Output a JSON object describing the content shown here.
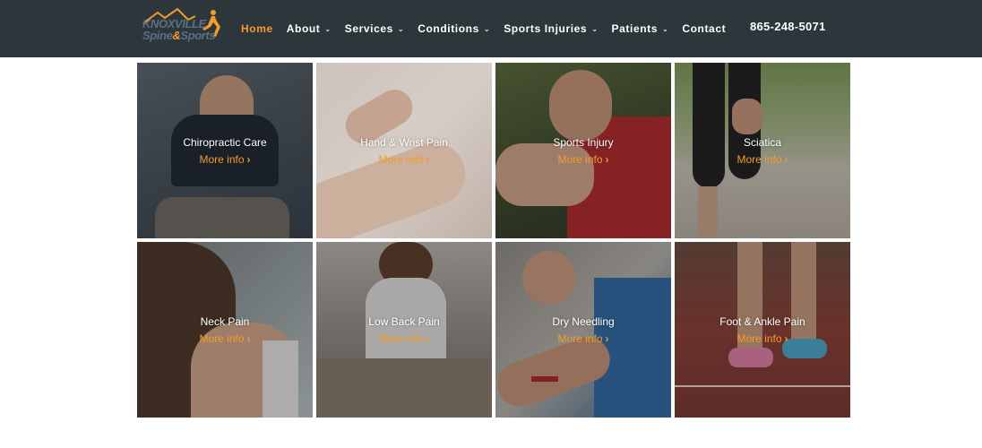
{
  "brand": {
    "line1": "KNOXVILLE",
    "line2a": "Spine",
    "amp": "&",
    "line2b": "Sports",
    "primary_color": "#2d363a",
    "accent_color": "#f49b2a"
  },
  "nav": {
    "items": [
      {
        "label": "Home",
        "active": true,
        "dropdown": false
      },
      {
        "label": "About",
        "dropdown": true
      },
      {
        "label": "Services",
        "dropdown": true
      },
      {
        "label": "Conditions",
        "dropdown": true
      },
      {
        "label": "Sports Injuries",
        "dropdown": true
      },
      {
        "label": "Patients",
        "dropdown": true
      },
      {
        "label": "Contact",
        "dropdown": false
      }
    ],
    "dropdown_icon": "chevron-down-icon",
    "chevron": "⌄"
  },
  "phone": "865-248-5071",
  "tiles": [
    {
      "title": "Chiropractic Care",
      "more": "More info"
    },
    {
      "title": "Hand & Wrist Pain",
      "more": "More info"
    },
    {
      "title": "Sports Injury",
      "more": "More info"
    },
    {
      "title": "Sciatica",
      "more": "More info"
    },
    {
      "title": "Neck Pain",
      "more": "More info"
    },
    {
      "title": "Low Back Pain",
      "more": "More info"
    },
    {
      "title": "Dry Needling",
      "more": "More info"
    },
    {
      "title": "Foot & Ankle Pain",
      "more": "More info"
    }
  ],
  "more_icon": "chevron-right-icon",
  "more_arrow": "›"
}
